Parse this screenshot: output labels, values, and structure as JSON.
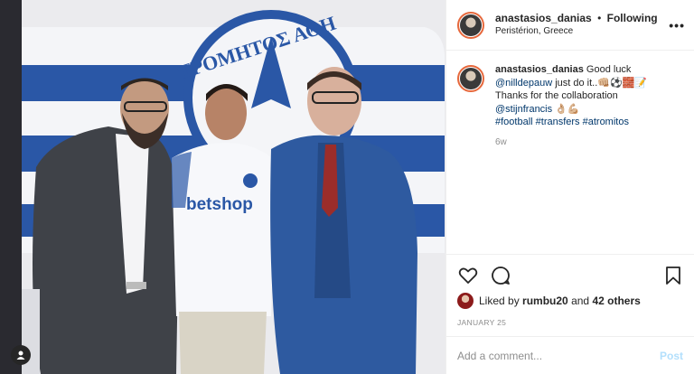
{
  "header": {
    "username": "anastasios_danias",
    "separator": "•",
    "follow_state": "Following",
    "location": "Peristérion, Greece",
    "more_label": "•••"
  },
  "photo": {
    "flag_text": "ΤΡΟΜΗΤΟΣ ΑΘΗ",
    "shirt_sponsor": "betshop",
    "icon": "user-tag-icon"
  },
  "caption": {
    "username": "anastasios_danias",
    "line1": "Good luck",
    "mention1": "@nilldepauw",
    "line2_rest": "just do it..👊🏼⚽🧱📝",
    "line3": "Thanks for the collaboration",
    "mention2": "@stijnfrancis",
    "line4_rest": "👌🏼💪🏼",
    "hashtags": "#football #transfers #atromitos",
    "age": "6w"
  },
  "actions": {
    "icons": [
      "heart-icon",
      "comment-icon",
      "bookmark-icon"
    ]
  },
  "likes": {
    "prefix": "Liked by",
    "user": "rumbu20",
    "middle": "and",
    "others": "42 others"
  },
  "date": "JANUARY 25",
  "comment_box": {
    "placeholder": "Add a comment...",
    "post_label": "Post"
  }
}
